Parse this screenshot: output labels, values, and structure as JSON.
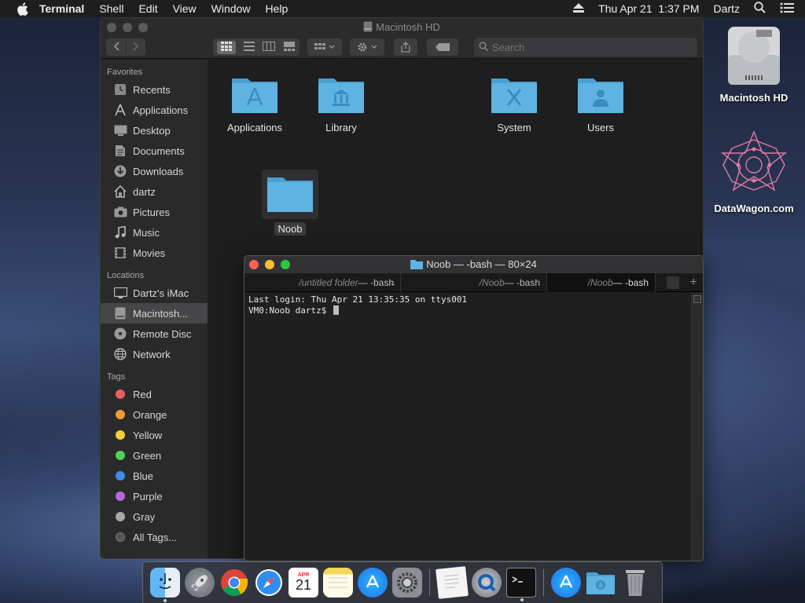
{
  "menubar": {
    "app_name": "Terminal",
    "menus": [
      "Shell",
      "Edit",
      "View",
      "Window",
      "Help"
    ],
    "datetime": "Thu Apr 21  1:37 PM",
    "user": "Dartz"
  },
  "finder": {
    "title": "Macintosh HD",
    "search_placeholder": "Search",
    "sidebar": {
      "favorites_label": "Favorites",
      "favorites": [
        "Recents",
        "Applications",
        "Desktop",
        "Documents",
        "Downloads",
        "dartz",
        "Pictures",
        "Music",
        "Movies"
      ],
      "locations_label": "Locations",
      "locations": [
        "Dartz's iMac",
        "Macintosh...",
        "Remote Disc",
        "Network"
      ],
      "tags_label": "Tags",
      "tags": [
        {
          "name": "Red",
          "color": "#ec5f5f"
        },
        {
          "name": "Orange",
          "color": "#f39a3c"
        },
        {
          "name": "Yellow",
          "color": "#f5cf3b"
        },
        {
          "name": "Green",
          "color": "#4fcf57"
        },
        {
          "name": "Blue",
          "color": "#3e8ef0"
        },
        {
          "name": "Purple",
          "color": "#b26ad9"
        },
        {
          "name": "Gray",
          "color": "#a8a8a8"
        }
      ],
      "all_tags": "All Tags..."
    },
    "items": [
      "Applications",
      "Library",
      "System",
      "Users",
      "Noob"
    ]
  },
  "terminal": {
    "title": "Noob — -bash — 80×24",
    "tabs": [
      {
        "folder": "/untitled folder",
        "cmd": " — -bash"
      },
      {
        "folder": "/Noob",
        "cmd": " — -bash"
      },
      {
        "folder": "/Noob",
        "cmd": " — -bash"
      }
    ],
    "tab_more": "...",
    "lines": [
      "Last login: Thu Apr 21 13:35:35 on ttys001",
      "VM0:Noob dartz$ "
    ]
  },
  "desktop": {
    "icons": [
      "Macintosh HD",
      "DataWagon.com"
    ]
  },
  "colors": {
    "folder_blue": "#5fb3e2",
    "close_red": "#fe5f57",
    "min_yellow": "#febc2e",
    "zoom_green": "#28c840"
  }
}
